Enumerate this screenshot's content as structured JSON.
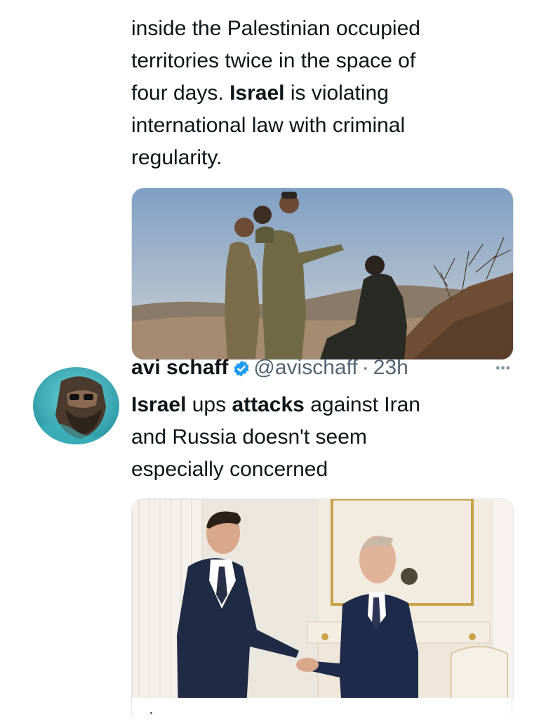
{
  "tweet1": {
    "text_lines": [
      "inside the Palestinian occupied",
      "territories twice in the space of",
      "four days. ",
      "Israel",
      " is violating",
      "international law with criminal",
      "regularity."
    ],
    "image_alt": "soldiers-on-hillside-photo"
  },
  "tweet2": {
    "author_name": "avi schaff",
    "handle": "@avischaff",
    "separator": "·",
    "time": "23h",
    "more_label": "•••",
    "text_parts": [
      "Israel",
      " ups ",
      "attacks",
      " against Iran",
      "and Russia doesn't seem",
      "especially concerned"
    ],
    "image_alt": "leaders-handshake-photo",
    "verified_color": "#1d9bf0"
  }
}
